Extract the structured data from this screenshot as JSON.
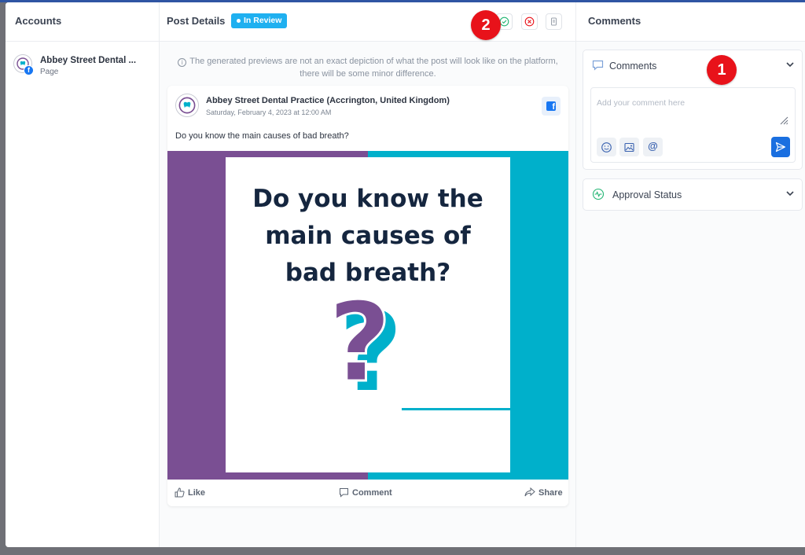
{
  "accounts": {
    "title": "Accounts",
    "items": [
      {
        "name": "Abbey Street Dental ...",
        "type": "Page",
        "network_icon": "facebook-icon"
      }
    ]
  },
  "post_details": {
    "title": "Post Details",
    "status_badge": "In Review",
    "actions": [
      {
        "icon": "approve-check-icon",
        "color": "#22b573"
      },
      {
        "icon": "reject-x-icon",
        "color": "#e8121a"
      },
      {
        "icon": "delete-icon",
        "color": "#9aa1ab"
      }
    ],
    "notice": "The generated previews are not an exact depiction of what the post will look like on the platform, there will be some minor difference.",
    "post": {
      "page_name": "Abbey Street Dental Practice (Accrington, United Kingdom)",
      "date": "Saturday, February 4, 2023 at 12:00 AM",
      "text": "Do you know the main causes of bad breath?",
      "image": {
        "headline_lines": [
          "Do you know the",
          "main causes of",
          "bad breath?"
        ],
        "colors": {
          "left": "#7a4f93",
          "right": "#00b0cb",
          "text": "#15263f"
        }
      },
      "actions": {
        "like": "Like",
        "comment": "Comment",
        "share": "Share"
      }
    }
  },
  "comments": {
    "title": "Comments",
    "panel_title": "Comments",
    "input_placeholder": "Add your comment here",
    "tools": [
      "emoji-icon",
      "image-upload-icon",
      "mention-icon"
    ],
    "mention_symbol": "@",
    "send_icon": "send-icon",
    "approval_title": "Approval Status"
  },
  "markers": {
    "one": "1",
    "two": "2"
  },
  "colors": {
    "accent": "#1a6fe0",
    "badge": "#1fb0f0",
    "marker": "#e8121a",
    "facebook": "#1877f2"
  }
}
